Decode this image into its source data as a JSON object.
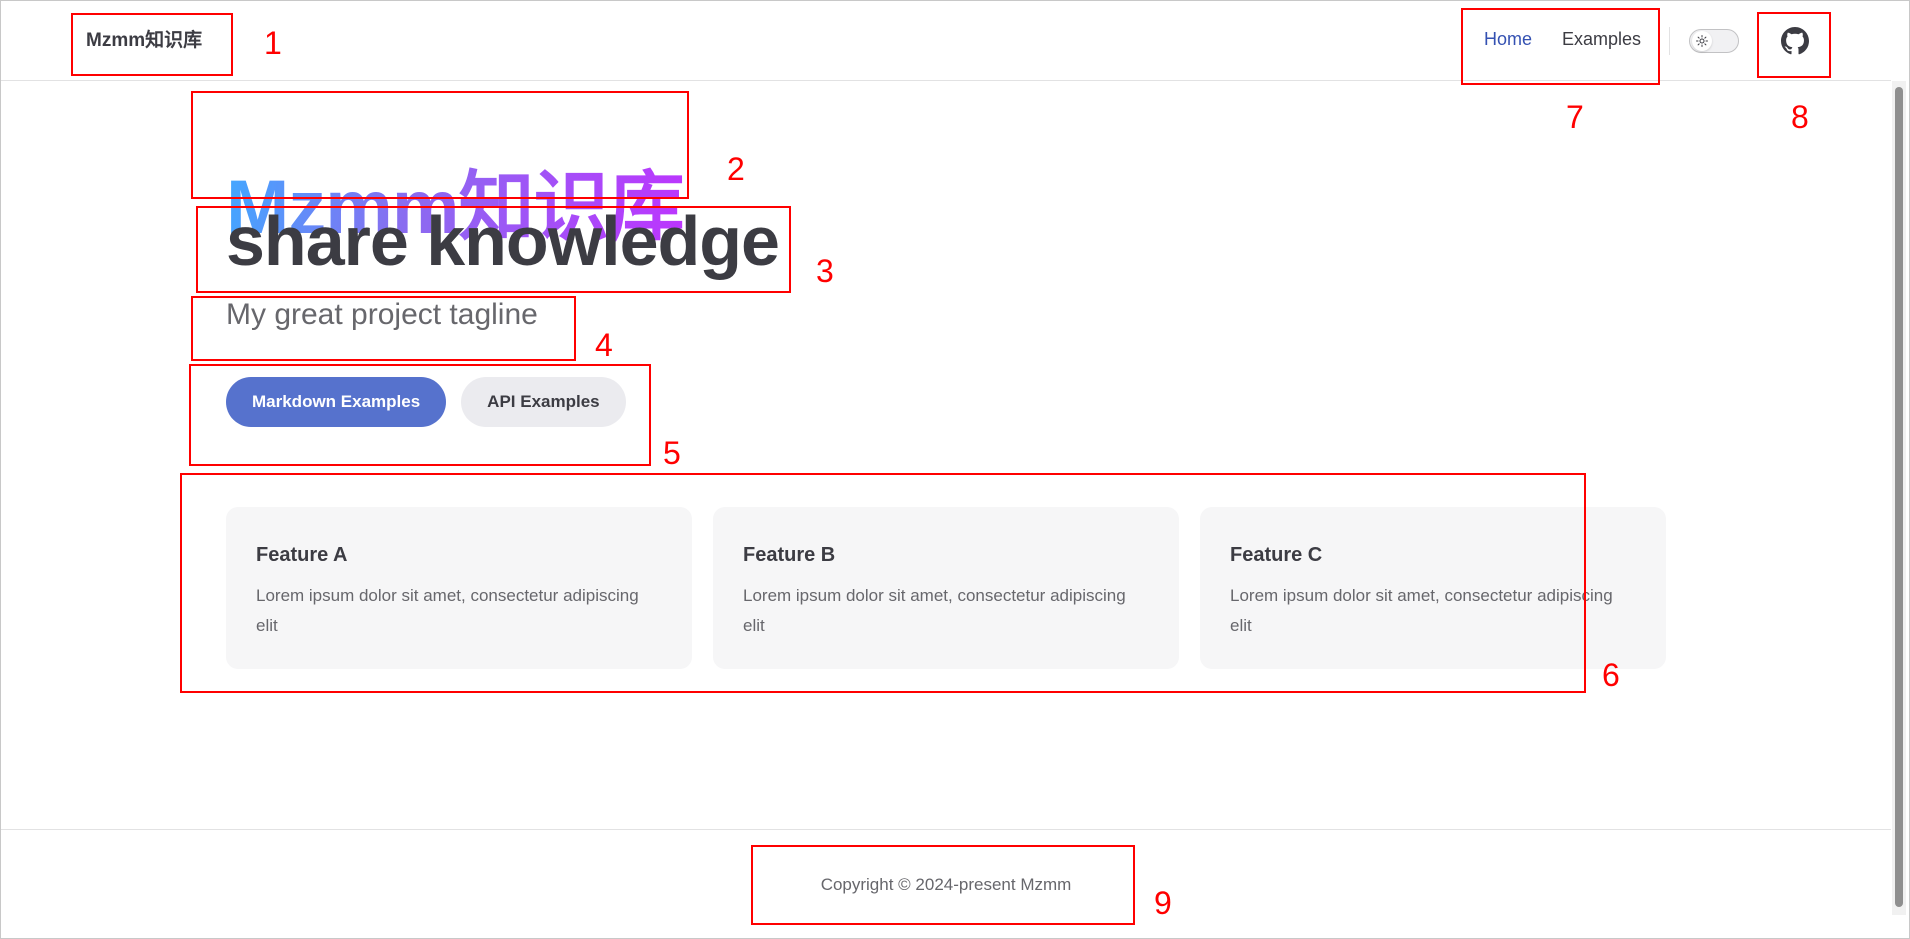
{
  "nav": {
    "site_title": "Mzmm知识库",
    "links": [
      {
        "label": "Home",
        "active": true
      },
      {
        "label": "Examples",
        "active": false
      }
    ],
    "theme_toggle_icon": "sun-icon",
    "social_icon": "github-icon"
  },
  "hero": {
    "name": "Mzmm知识库",
    "text": "share knowledge",
    "tagline": "My great project tagline",
    "actions": [
      {
        "label": "Markdown Examples",
        "theme": "brand"
      },
      {
        "label": "API Examples",
        "theme": "alt"
      }
    ]
  },
  "features": [
    {
      "title": "Feature A",
      "details": "Lorem ipsum dolor sit amet, consectetur adipiscing elit"
    },
    {
      "title": "Feature B",
      "details": "Lorem ipsum dolor sit amet, consectetur adipiscing elit"
    },
    {
      "title": "Feature C",
      "details": "Lorem ipsum dolor sit amet, consectetur adipiscing elit"
    }
  ],
  "footer": {
    "copyright": "Copyright © 2024-present Mzmm"
  },
  "annotations": [
    "1",
    "2",
    "3",
    "4",
    "5",
    "6",
    "7",
    "8",
    "9"
  ],
  "colors": {
    "brand": "#5672cd",
    "active_link": "#3451b2",
    "annotation": "#ff0000",
    "gradient_start": "#41a8ff",
    "gradient_end": "#bd34fe"
  }
}
